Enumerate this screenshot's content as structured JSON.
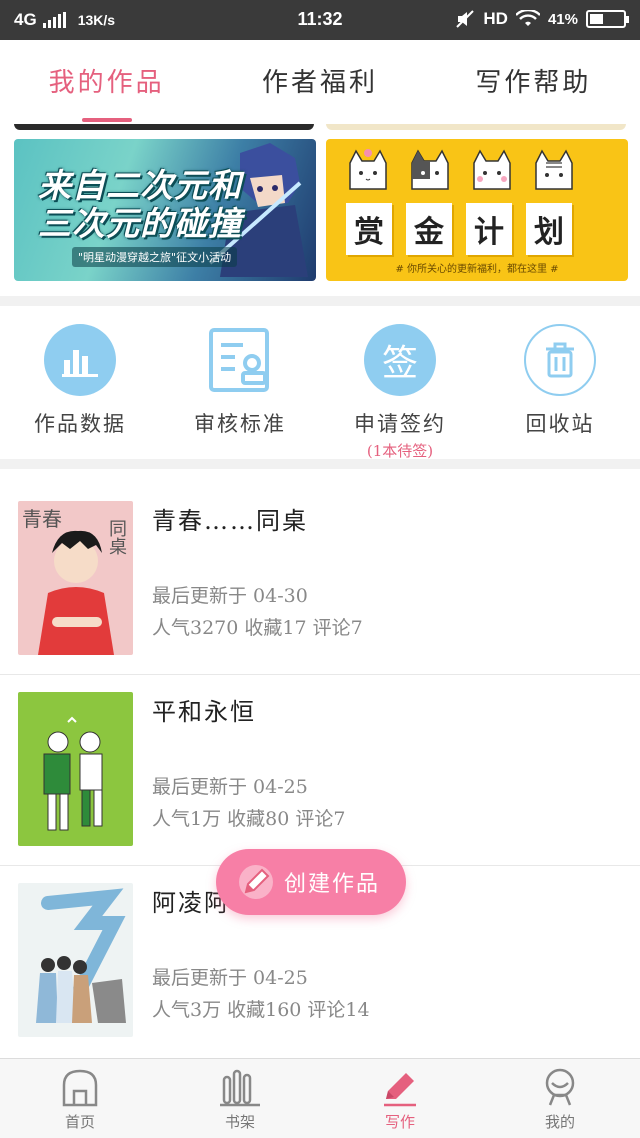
{
  "status_bar": {
    "network": "4G",
    "speed": "13K/s",
    "time": "11:32",
    "hd": "HD",
    "battery_text": "41%",
    "battery_level": 0.41
  },
  "top_tabs": [
    {
      "label": "我的作品",
      "active": true
    },
    {
      "label": "作者福利",
      "active": false
    },
    {
      "label": "写作帮助",
      "active": false
    }
  ],
  "banners": {
    "left": {
      "line1": "来自二次元和",
      "line2": "三次元的碰撞",
      "subtitle": "\"明星动漫穿越之旅\"征文小活动"
    },
    "right": {
      "chars": [
        "赏",
        "金",
        "计",
        "划"
      ],
      "note": "# 你所关心的更新福利，都在这里 #"
    }
  },
  "quick_actions": [
    {
      "label": "作品数据",
      "icon": "bar-chart-icon"
    },
    {
      "label": "审核标准",
      "icon": "document-icon"
    },
    {
      "label": "申请签约",
      "icon": "sign-icon",
      "sub": "(1本待签)",
      "icon_text": "签"
    },
    {
      "label": "回收站",
      "icon": "trash-icon"
    }
  ],
  "works": [
    {
      "title": "青春……同桌",
      "updated": "最后更新于  04-30",
      "stats": "人气3270  收藏17  评论7",
      "cover_text1": "青春",
      "cover_text2": "同桌"
    },
    {
      "title": "平和永恒",
      "updated": "最后更新于  04-25",
      "stats": "人气1万  收藏80  评论7"
    },
    {
      "title": "阿凌阿",
      "updated": "最后更新于  04-25",
      "stats": "人气3万  收藏160  评论14"
    }
  ],
  "create_button": {
    "label": "创建作品"
  },
  "bottom_nav": [
    {
      "label": "首页",
      "icon": "home-icon",
      "active": false
    },
    {
      "label": "书架",
      "icon": "bookshelf-icon",
      "active": false
    },
    {
      "label": "写作",
      "icon": "pen-icon",
      "active": true
    },
    {
      "label": "我的",
      "icon": "profile-icon",
      "active": false
    }
  ],
  "colors": {
    "accent": "#e5607e",
    "icon_blue": "#8fcdf0",
    "create_button": "#f77fa6",
    "banner_yellow": "#f9c416"
  }
}
